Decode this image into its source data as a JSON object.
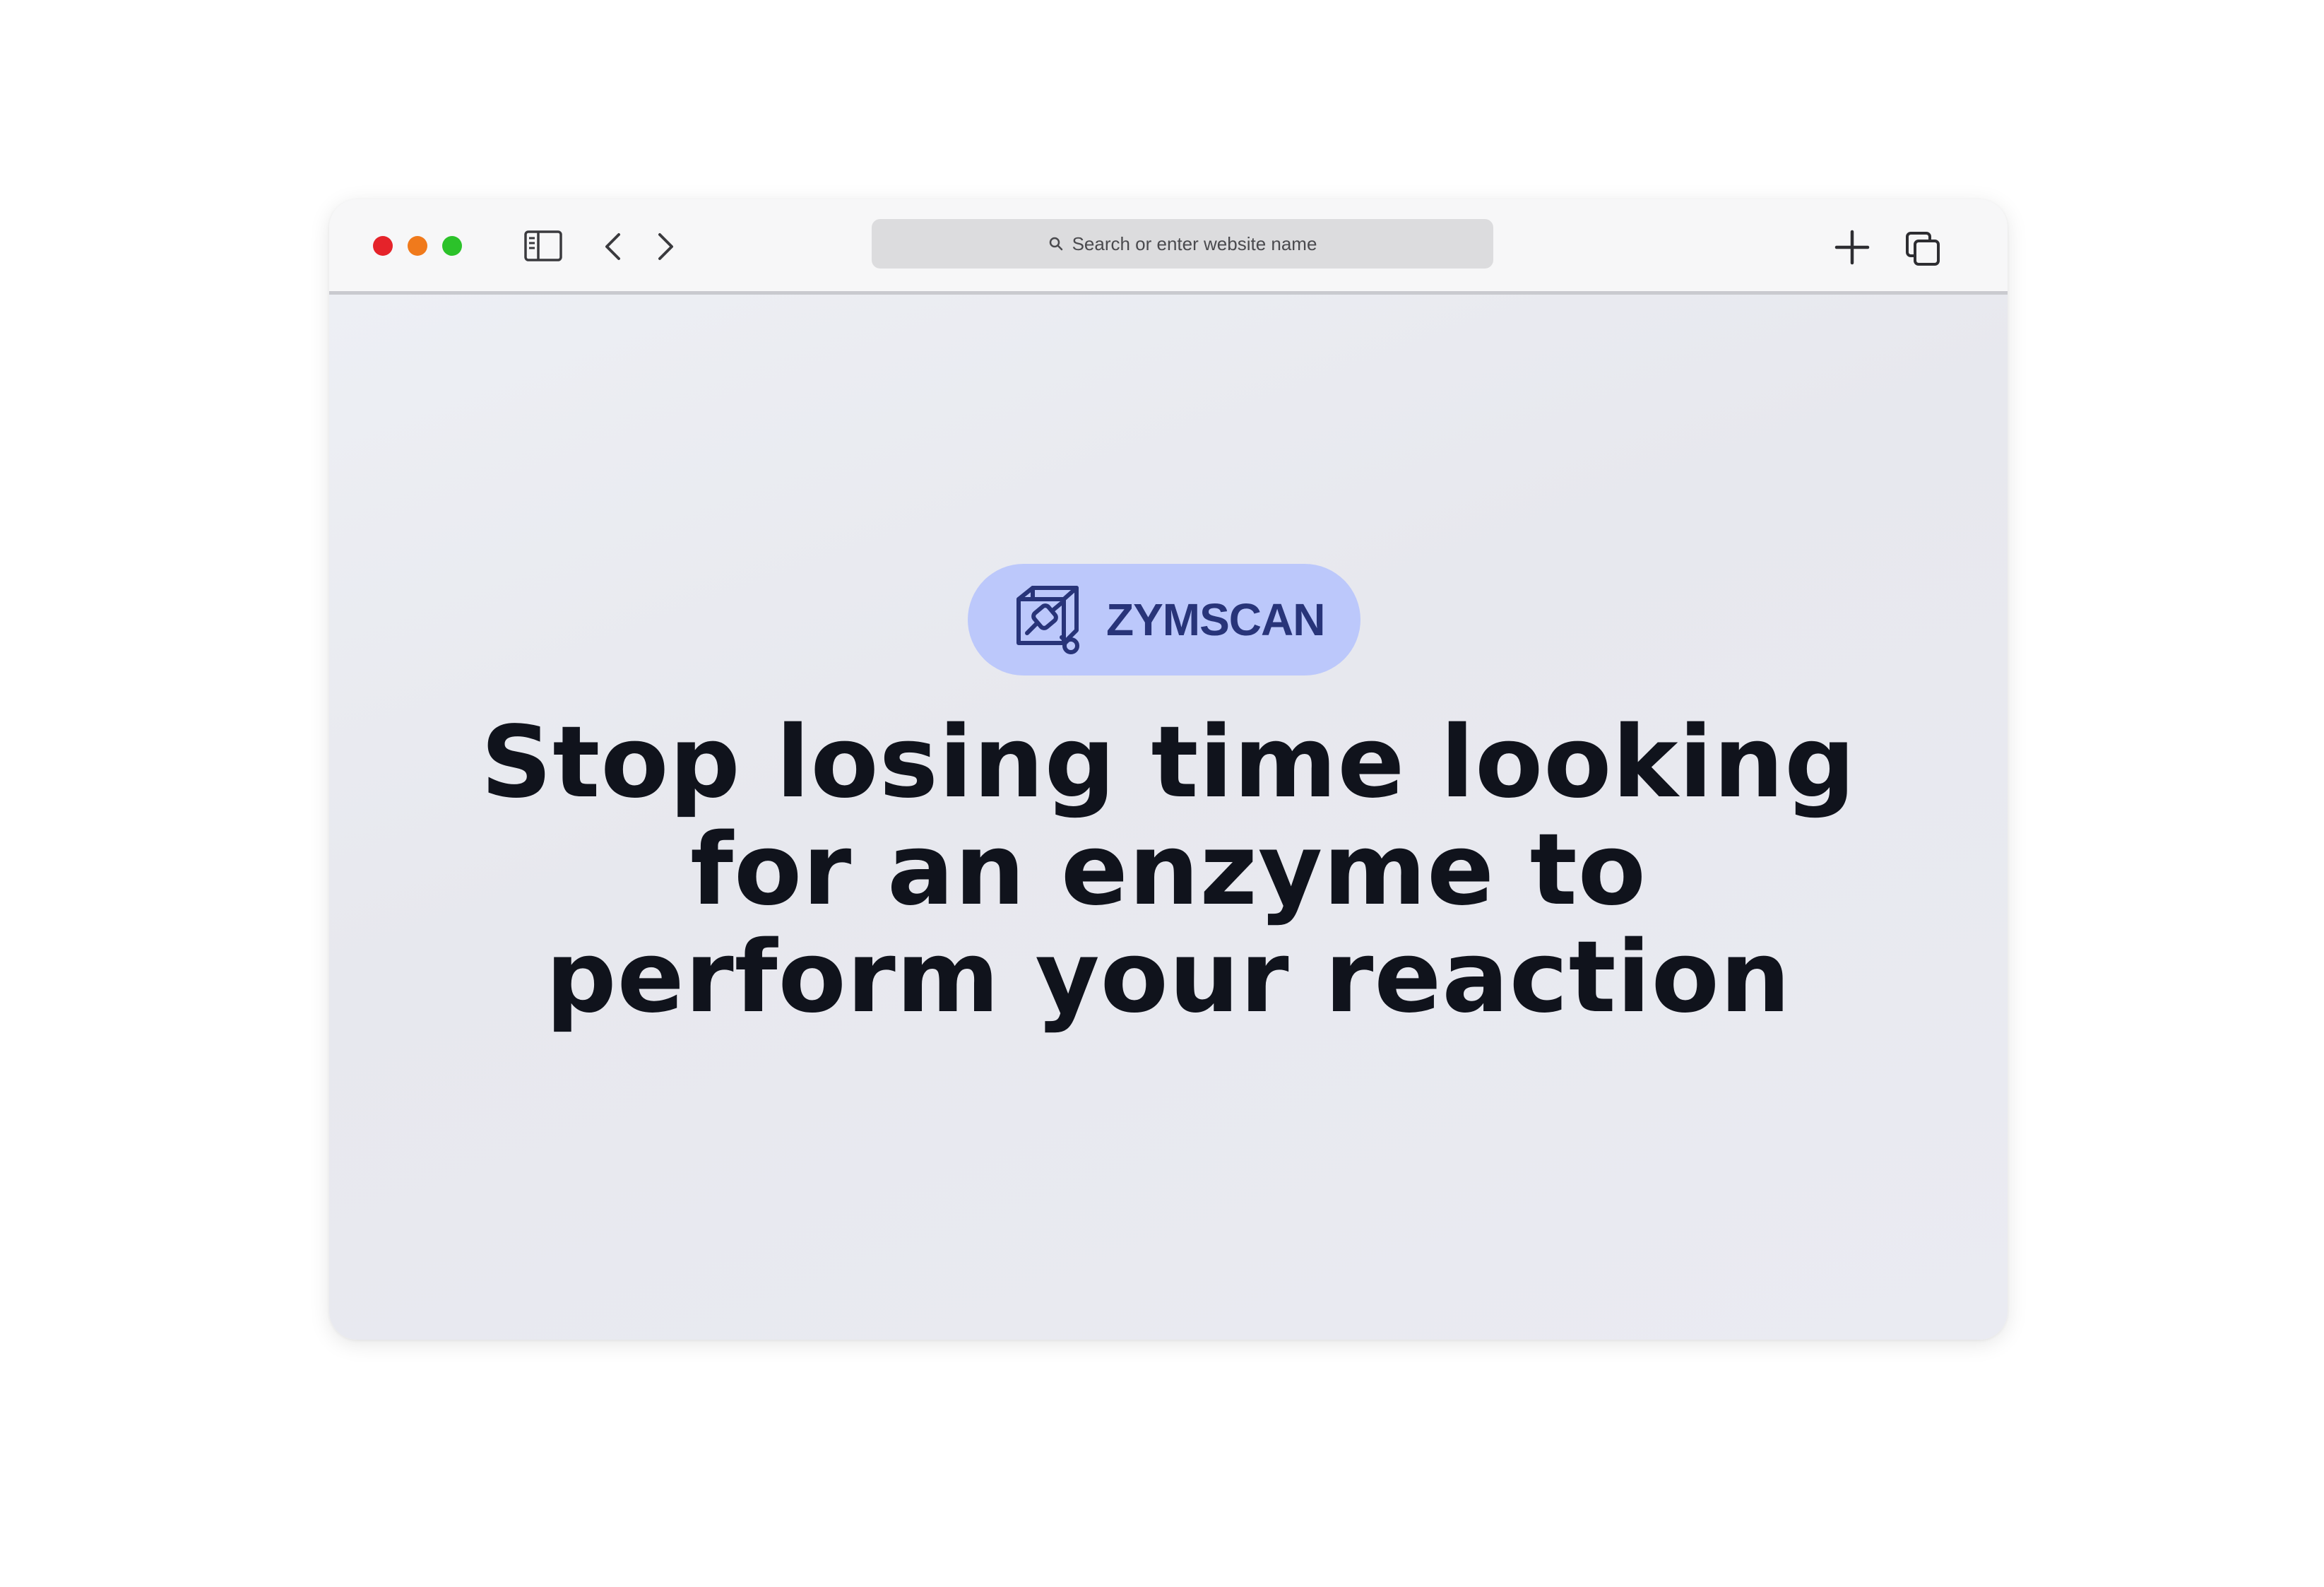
{
  "browser": {
    "window_controls": [
      "close",
      "minimize",
      "maximize"
    ],
    "address_bar": {
      "placeholder": "Search or enter website name",
      "icon": "search-icon"
    },
    "toolbar_icons": [
      "sidebar-icon",
      "back-icon",
      "forward-icon",
      "new-tab-icon",
      "tabs-overview-icon"
    ]
  },
  "page": {
    "brand": {
      "name": "ZYMSCAN",
      "icon": "zymscan-logo-icon",
      "pill_color": "#bcc8fb",
      "text_color": "#283479"
    },
    "headline_lines": [
      "Stop losing time looking",
      "for an enzyme to",
      "perform your reaction"
    ]
  },
  "colors": {
    "close": "#e5232a",
    "minimize": "#f07a1c",
    "maximize": "#2cc22a",
    "headline": "#10131c"
  }
}
